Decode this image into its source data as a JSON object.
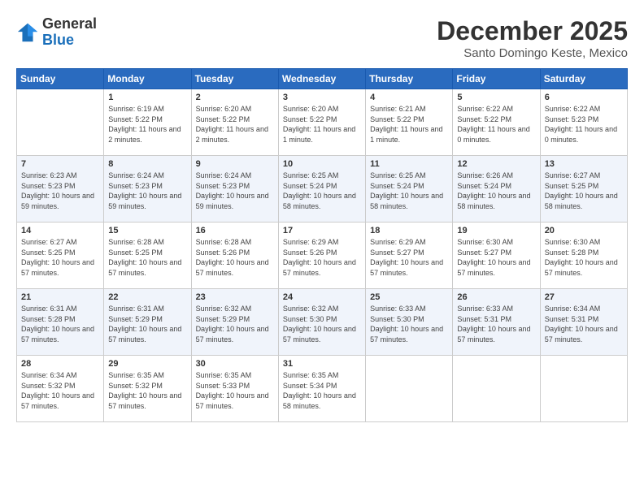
{
  "header": {
    "logo_general": "General",
    "logo_blue": "Blue",
    "month": "December 2025",
    "location": "Santo Domingo Keste, Mexico"
  },
  "days_of_week": [
    "Sunday",
    "Monday",
    "Tuesday",
    "Wednesday",
    "Thursday",
    "Friday",
    "Saturday"
  ],
  "weeks": [
    [
      {
        "day": "",
        "sunrise": "",
        "sunset": "",
        "daylight": ""
      },
      {
        "day": "1",
        "sunrise": "Sunrise: 6:19 AM",
        "sunset": "Sunset: 5:22 PM",
        "daylight": "Daylight: 11 hours and 2 minutes."
      },
      {
        "day": "2",
        "sunrise": "Sunrise: 6:20 AM",
        "sunset": "Sunset: 5:22 PM",
        "daylight": "Daylight: 11 hours and 2 minutes."
      },
      {
        "day": "3",
        "sunrise": "Sunrise: 6:20 AM",
        "sunset": "Sunset: 5:22 PM",
        "daylight": "Daylight: 11 hours and 1 minute."
      },
      {
        "day": "4",
        "sunrise": "Sunrise: 6:21 AM",
        "sunset": "Sunset: 5:22 PM",
        "daylight": "Daylight: 11 hours and 1 minute."
      },
      {
        "day": "5",
        "sunrise": "Sunrise: 6:22 AM",
        "sunset": "Sunset: 5:22 PM",
        "daylight": "Daylight: 11 hours and 0 minutes."
      },
      {
        "day": "6",
        "sunrise": "Sunrise: 6:22 AM",
        "sunset": "Sunset: 5:23 PM",
        "daylight": "Daylight: 11 hours and 0 minutes."
      }
    ],
    [
      {
        "day": "7",
        "sunrise": "Sunrise: 6:23 AM",
        "sunset": "Sunset: 5:23 PM",
        "daylight": "Daylight: 10 hours and 59 minutes."
      },
      {
        "day": "8",
        "sunrise": "Sunrise: 6:24 AM",
        "sunset": "Sunset: 5:23 PM",
        "daylight": "Daylight: 10 hours and 59 minutes."
      },
      {
        "day": "9",
        "sunrise": "Sunrise: 6:24 AM",
        "sunset": "Sunset: 5:23 PM",
        "daylight": "Daylight: 10 hours and 59 minutes."
      },
      {
        "day": "10",
        "sunrise": "Sunrise: 6:25 AM",
        "sunset": "Sunset: 5:24 PM",
        "daylight": "Daylight: 10 hours and 58 minutes."
      },
      {
        "day": "11",
        "sunrise": "Sunrise: 6:25 AM",
        "sunset": "Sunset: 5:24 PM",
        "daylight": "Daylight: 10 hours and 58 minutes."
      },
      {
        "day": "12",
        "sunrise": "Sunrise: 6:26 AM",
        "sunset": "Sunset: 5:24 PM",
        "daylight": "Daylight: 10 hours and 58 minutes."
      },
      {
        "day": "13",
        "sunrise": "Sunrise: 6:27 AM",
        "sunset": "Sunset: 5:25 PM",
        "daylight": "Daylight: 10 hours and 58 minutes."
      }
    ],
    [
      {
        "day": "14",
        "sunrise": "Sunrise: 6:27 AM",
        "sunset": "Sunset: 5:25 PM",
        "daylight": "Daylight: 10 hours and 57 minutes."
      },
      {
        "day": "15",
        "sunrise": "Sunrise: 6:28 AM",
        "sunset": "Sunset: 5:25 PM",
        "daylight": "Daylight: 10 hours and 57 minutes."
      },
      {
        "day": "16",
        "sunrise": "Sunrise: 6:28 AM",
        "sunset": "Sunset: 5:26 PM",
        "daylight": "Daylight: 10 hours and 57 minutes."
      },
      {
        "day": "17",
        "sunrise": "Sunrise: 6:29 AM",
        "sunset": "Sunset: 5:26 PM",
        "daylight": "Daylight: 10 hours and 57 minutes."
      },
      {
        "day": "18",
        "sunrise": "Sunrise: 6:29 AM",
        "sunset": "Sunset: 5:27 PM",
        "daylight": "Daylight: 10 hours and 57 minutes."
      },
      {
        "day": "19",
        "sunrise": "Sunrise: 6:30 AM",
        "sunset": "Sunset: 5:27 PM",
        "daylight": "Daylight: 10 hours and 57 minutes."
      },
      {
        "day": "20",
        "sunrise": "Sunrise: 6:30 AM",
        "sunset": "Sunset: 5:28 PM",
        "daylight": "Daylight: 10 hours and 57 minutes."
      }
    ],
    [
      {
        "day": "21",
        "sunrise": "Sunrise: 6:31 AM",
        "sunset": "Sunset: 5:28 PM",
        "daylight": "Daylight: 10 hours and 57 minutes."
      },
      {
        "day": "22",
        "sunrise": "Sunrise: 6:31 AM",
        "sunset": "Sunset: 5:29 PM",
        "daylight": "Daylight: 10 hours and 57 minutes."
      },
      {
        "day": "23",
        "sunrise": "Sunrise: 6:32 AM",
        "sunset": "Sunset: 5:29 PM",
        "daylight": "Daylight: 10 hours and 57 minutes."
      },
      {
        "day": "24",
        "sunrise": "Sunrise: 6:32 AM",
        "sunset": "Sunset: 5:30 PM",
        "daylight": "Daylight: 10 hours and 57 minutes."
      },
      {
        "day": "25",
        "sunrise": "Sunrise: 6:33 AM",
        "sunset": "Sunset: 5:30 PM",
        "daylight": "Daylight: 10 hours and 57 minutes."
      },
      {
        "day": "26",
        "sunrise": "Sunrise: 6:33 AM",
        "sunset": "Sunset: 5:31 PM",
        "daylight": "Daylight: 10 hours and 57 minutes."
      },
      {
        "day": "27",
        "sunrise": "Sunrise: 6:34 AM",
        "sunset": "Sunset: 5:31 PM",
        "daylight": "Daylight: 10 hours and 57 minutes."
      }
    ],
    [
      {
        "day": "28",
        "sunrise": "Sunrise: 6:34 AM",
        "sunset": "Sunset: 5:32 PM",
        "daylight": "Daylight: 10 hours and 57 minutes."
      },
      {
        "day": "29",
        "sunrise": "Sunrise: 6:35 AM",
        "sunset": "Sunset: 5:32 PM",
        "daylight": "Daylight: 10 hours and 57 minutes."
      },
      {
        "day": "30",
        "sunrise": "Sunrise: 6:35 AM",
        "sunset": "Sunset: 5:33 PM",
        "daylight": "Daylight: 10 hours and 57 minutes."
      },
      {
        "day": "31",
        "sunrise": "Sunrise: 6:35 AM",
        "sunset": "Sunset: 5:34 PM",
        "daylight": "Daylight: 10 hours and 58 minutes."
      },
      {
        "day": "",
        "sunrise": "",
        "sunset": "",
        "daylight": ""
      },
      {
        "day": "",
        "sunrise": "",
        "sunset": "",
        "daylight": ""
      },
      {
        "day": "",
        "sunrise": "",
        "sunset": "",
        "daylight": ""
      }
    ]
  ]
}
